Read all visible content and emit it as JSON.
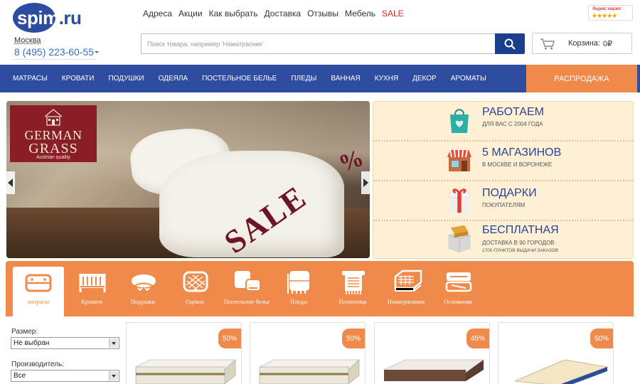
{
  "header": {
    "logo": {
      "main": "spim",
      "suffix": ".ru"
    },
    "city": "Москва",
    "phone": "8 (495) 223-60-55",
    "nav": [
      "Адреса",
      "Акции",
      "Как выбрать",
      "Доставка",
      "Отзывы",
      "Мебель",
      "SALE"
    ],
    "yandex": {
      "label": "Яндекс маркет",
      "stars": "★★★★★"
    },
    "search_placeholder": "Поиск товара, например 'Наматрасник'",
    "cart_label": "Корзина:",
    "cart_sum": "0₽"
  },
  "main_nav": {
    "items": [
      "МАТРАСЫ",
      "КРОВАТИ",
      "ПОДУШКИ",
      "ОДЕЯЛА",
      "ПОСТЕЛЬНОЕ БЕЛЬЕ",
      "ПЛЕДЫ",
      "ВАННАЯ",
      "КУХНЯ",
      "ДЕКОР",
      "АРОМАТЫ"
    ],
    "sale": "РАСПРОДАЖА"
  },
  "slider": {
    "brand_line1": "GERMAN",
    "brand_line2": "GRASS",
    "brand_line3": "Austrian quality",
    "sale_text": "SALE",
    "percent": "%"
  },
  "info": [
    {
      "title": "РАБОТАЕМ",
      "sub": "ДЛЯ ВАС С 2004 ГОДА",
      "icon": "shopping-bag-icon"
    },
    {
      "title": "5 МАГАЗИНОВ",
      "sub": "В МОСКВЕ И ВОРОНЕЖЕ",
      "icon": "store-icon"
    },
    {
      "title": "ПОДАРКИ",
      "sub": "ПОКУПАТЕЛЯМ",
      "icon": "gift-icon"
    },
    {
      "title": "БЕСПЛАТНАЯ",
      "sub": "ДОСТАВКА В 90 ГОРОДОВ",
      "sub2": "1700 ПУНКТОВ ВЫДАЧИ ЗАКАЗОВ",
      "icon": "delivery-box-icon"
    }
  ],
  "categories": [
    {
      "label": "матрасы",
      "icon": "mattress-icon"
    },
    {
      "label": "Кровати",
      "icon": "bed-icon"
    },
    {
      "label": "Подушки",
      "icon": "pillow-icon"
    },
    {
      "label": "Одеяла",
      "icon": "blanket-icon"
    },
    {
      "label": "Постельное белье",
      "icon": "bed-linen-icon"
    },
    {
      "label": "Пледы",
      "icon": "plaid-icon"
    },
    {
      "label": "Полотенца",
      "icon": "towel-icon"
    },
    {
      "label": "Наматрасники",
      "icon": "mattress-topper-icon"
    },
    {
      "label": "Основания",
      "icon": "bed-base-icon"
    }
  ],
  "filters": {
    "size_label": "Размер:",
    "size_value": "Не выбран",
    "maker_label": "Производитель:",
    "maker_value": "Все"
  },
  "products": [
    {
      "discount": "50%"
    },
    {
      "discount": "50%"
    },
    {
      "discount": "45%"
    },
    {
      "discount": "50%"
    }
  ],
  "colors": {
    "brand_blue": "#2f4da0",
    "accent_orange": "#f08a4b",
    "sale_red": "#d6231a"
  }
}
